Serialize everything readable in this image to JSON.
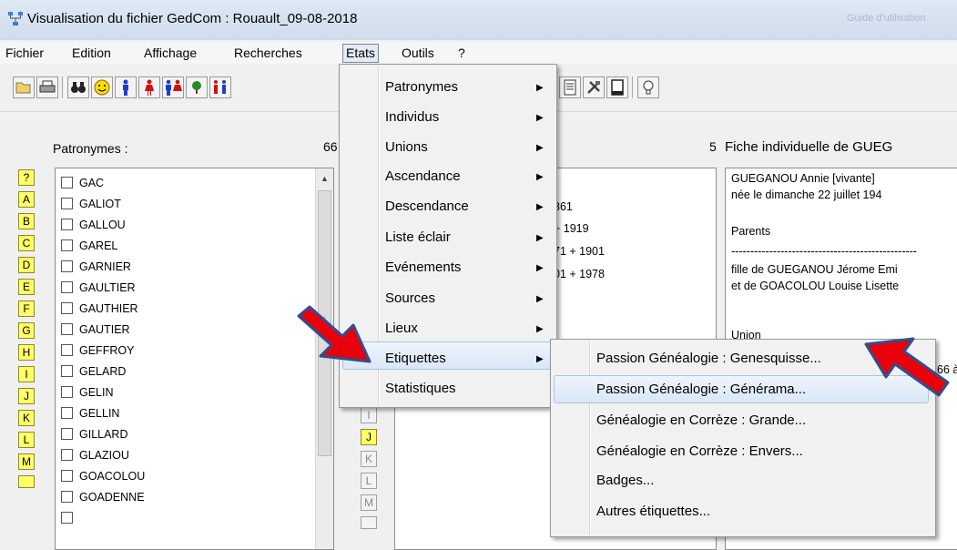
{
  "window": {
    "title": "Visualisation du fichier GedCom : Rouault_09-08-2018",
    "ghost_title": "Guide d'utilisation"
  },
  "menubar": {
    "items": [
      "Fichier",
      "Edition",
      "Affichage",
      "Recherches",
      "Etats",
      "Outils",
      "?"
    ],
    "active": "Etats"
  },
  "toolbar": {
    "icons": [
      "open-folder-icon",
      "print-icon",
      "binoculars-icon",
      "smiley-icon",
      "man-icon",
      "woman-icon",
      "couple-icon",
      "tree-icon",
      "family-icon",
      "document-icon",
      "tools-icon",
      "page-icon",
      "lightbulb-icon"
    ]
  },
  "left_panel": {
    "label": "Patronymes :",
    "count": "66",
    "letters": [
      "?",
      "A",
      "B",
      "C",
      "D",
      "E",
      "F",
      "G",
      "H",
      "I",
      "J",
      "K",
      "L",
      "M"
    ],
    "surnames": [
      "GAC",
      "GALIOT",
      "GALLOU",
      "GAREL",
      "GARNIER",
      "GAULTIER",
      "GAUTHIER",
      "GAUTIER",
      "GEFFROY",
      "GELARD",
      "GELIN",
      "GELLIN",
      "GILLARD",
      "GLAZIOU",
      "GOACOLOU",
      "GOADENNE"
    ]
  },
  "middle_panel": {
    "count": "5",
    "letters": [
      "I",
      "J",
      "K",
      "L",
      "M"
    ],
    "active_letter": "J",
    "partial_rows": [
      "361",
      "+ 1919",
      "71 + 1901",
      "01 + 1978"
    ]
  },
  "right_panel": {
    "title": "Fiche individuelle de GUEG",
    "lines": [
      "GUEGANOU Annie [vivante]",
      "née le dimanche 22 juillet 194",
      "",
      "Parents",
      "-------------------------------------------------",
      "fille de GUEGANOU Jérome Emi",
      "et de GOACOLOU Louise Lisette",
      "",
      "Union",
      "",
      "66 à"
    ]
  },
  "etats_menu": {
    "items": [
      "Patronymes",
      "Individus",
      "Unions",
      "Ascendance",
      "Descendance",
      "Liste éclair",
      "Evénements",
      "Sources",
      "Lieux",
      "Etiquettes",
      "Statistiques"
    ],
    "has_submenu": [
      true,
      true,
      true,
      true,
      true,
      true,
      true,
      true,
      true,
      true,
      false
    ],
    "highlighted": "Etiquettes"
  },
  "etiquettes_submenu": {
    "items": [
      "Passion Généalogie : Genesquisse...",
      "Passion Généalogie : Générama...",
      "Généalogie en Corrèze : Grande...",
      "Généalogie en Corrèze : Envers...",
      "Badges...",
      "Autres étiquettes..."
    ],
    "highlighted": "Passion Généalogie : Générama..."
  },
  "colors": {
    "arrow_fill": "#e8000b",
    "arrow_outline": "#2f4f8f",
    "letter_yellow": "#ffff66"
  }
}
